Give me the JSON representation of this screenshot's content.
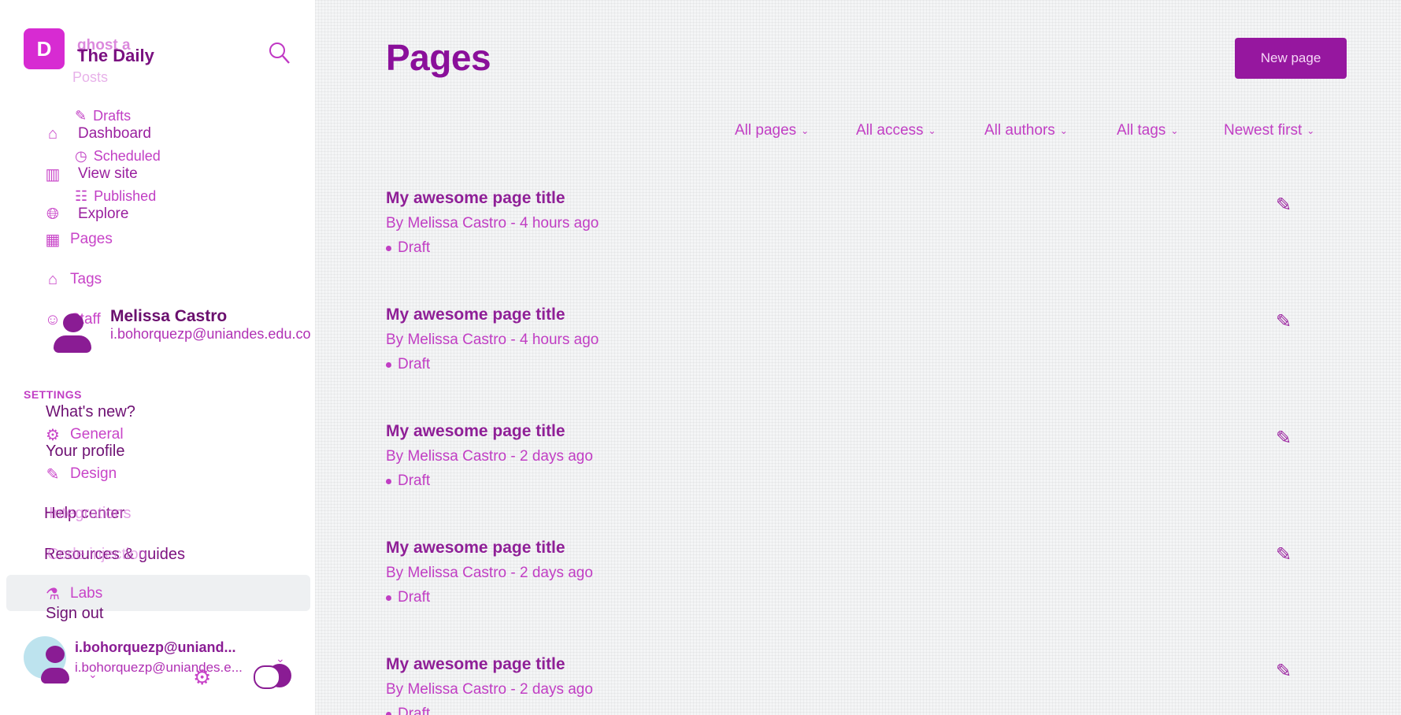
{
  "sidebar": {
    "logo_letter": "D",
    "site_title": "The Daily",
    "site_title_ghost": "ghost a",
    "ghost_fragment": "Posts",
    "nav": [
      {
        "icon": "home-icon",
        "label": "Dashboard"
      },
      {
        "icon": "view-site-icon",
        "label": "View site"
      },
      {
        "icon": "globe-icon",
        "label": "Explore"
      },
      {
        "icon": "pages-icon",
        "label": "Pages"
      },
      {
        "icon": "tag-icon",
        "label": "Tags"
      },
      {
        "icon": "staff-icon",
        "label": "Staff"
      }
    ],
    "posts_sub": [
      {
        "icon": "drafts-icon",
        "label": "Drafts"
      },
      {
        "icon": "clock-icon",
        "label": "Scheduled"
      },
      {
        "icon": "published-icon",
        "label": "Published"
      }
    ],
    "user_card": {
      "name": "Melissa Castro",
      "email": "i.bohorquezp@uniandes.edu.co"
    },
    "settings_header": "SETTINGS",
    "menu": {
      "whats_new": "What's new?",
      "your_profile": "Your profile",
      "help_center": "Help center",
      "help_ghost": "Integrations",
      "resources": "Resources & guides",
      "resources_ghost": "Code injection",
      "sign_out": "Sign out"
    },
    "settings_items": [
      {
        "icon": "gear-icon",
        "label": "General"
      },
      {
        "icon": "brush-icon",
        "label": "Design"
      },
      {
        "icon": "flask-icon",
        "label": "Labs"
      }
    ],
    "footer": {
      "email_bold": "i.bohorquezp@uniand...",
      "email": "i.bohorquezp@uniandes.e..."
    }
  },
  "main": {
    "title": "Pages",
    "new_page_label": "New page",
    "filters": [
      "All pages",
      "All access",
      "All authors",
      "All tags",
      "Newest first"
    ],
    "rows": [
      {
        "title": "My awesome page title",
        "meta": "By Melissa Castro - 4 hours ago",
        "status": "Draft"
      },
      {
        "title": "My awesome page title",
        "meta": "By Melissa Castro - 4 hours ago",
        "status": "Draft"
      },
      {
        "title": "My awesome page title",
        "meta": "By Melissa Castro - 2 days ago",
        "status": "Draft"
      },
      {
        "title": "My awesome page title",
        "meta": "By Melissa Castro - 2 days ago",
        "status": "Draft"
      },
      {
        "title": "My awesome page title",
        "meta": "By Melissa Castro - 2 days ago",
        "status": "Draft"
      }
    ]
  }
}
